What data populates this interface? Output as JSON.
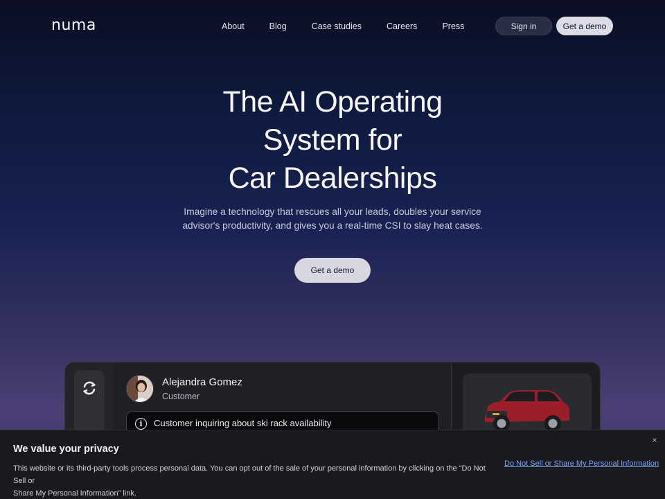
{
  "nav": {
    "logo": "numa",
    "links": [
      "About",
      "Blog",
      "Case studies",
      "Careers",
      "Press"
    ],
    "signin_label": "Sign in",
    "demo_label": "Get a demo"
  },
  "hero": {
    "title_line1": "The AI Operating",
    "title_line2": "System for",
    "title_line3": "Car Dealerships",
    "subtitle_line1": "Imagine a technology that rescues all your leads, doubles your service",
    "subtitle_line2": "advisor's productivity, and gives you a real-time CSI to slay heat cases.",
    "cta_label": "Get a demo"
  },
  "preview": {
    "customer_name": "Alejandra Gomez",
    "customer_role": "Customer",
    "notice_text": "Customer inquiring about ski rack availability",
    "car_color": "#9b1f2b"
  },
  "cookie": {
    "title": "We value your privacy",
    "body_line1": "This website or its third-party tools process personal data. You can opt out of the sale of your personal information by clicking on the “Do Not Sell or",
    "body_line2": "Share My Personal Information” link.",
    "link": "Do Not Sell or Share My Personal Information",
    "close": "×"
  },
  "colors": {
    "link": "#7aa6ff",
    "button_light": "#dcdce6"
  }
}
